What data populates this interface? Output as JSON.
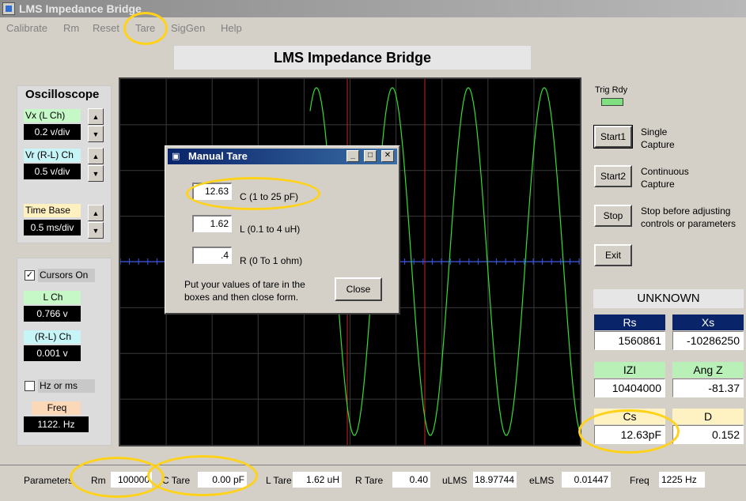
{
  "window": {
    "title": "LMS Impedance Bridge"
  },
  "menu": [
    "Calibrate",
    "Rm",
    "Reset",
    "Tare",
    "SigGen",
    "Help"
  ],
  "banner": "LMS Impedance Bridge",
  "oscilloscope": {
    "title": "Oscilloscope",
    "vx_label": "Vx  (L Ch)",
    "vx_value": "0.2 v/div",
    "vr_label": "Vr (R-L) Ch",
    "vr_value": "0.5 v/div",
    "timebase_label": "Time Base",
    "timebase_value": "0.5 ms/div"
  },
  "cursors": {
    "cursors_label": "Cursors On",
    "cursors_checked": "✓",
    "lch_label": "L Ch",
    "lch_value": "0.766 v",
    "rl_label": "(R-L) Ch",
    "rl_value": "0.001 v",
    "hz_label": "Hz or ms",
    "freq_label": "Freq",
    "freq_value": "1122. Hz"
  },
  "controls": {
    "trig_label": "Trig Rdy",
    "start1": "Start1",
    "start1_desc_1": "Single",
    "start1_desc_2": "Capture",
    "start2": "Start2",
    "start2_desc_1": "Continuous",
    "start2_desc_2": "Capture",
    "stop": "Stop",
    "stop_desc_1": "Stop before adjusting",
    "stop_desc_2": "controls or parameters",
    "exit": "Exit"
  },
  "unknown": {
    "title": "UNKNOWN",
    "rs_label": "Rs",
    "rs_value": "1560861",
    "xs_label": "Xs",
    "xs_value": "-10286250",
    "z_label": "IZI",
    "z_value": "10404000",
    "angz_label": "Ang Z",
    "angz_value": "-81.37",
    "cs_label": "Cs",
    "cs_value": "12.63pF",
    "d_label": "D",
    "d_value": "0.152"
  },
  "dialog": {
    "title": "Manual Tare",
    "c_value": "12.63",
    "c_label": "C  (1 to 25 pF)",
    "l_value": "1.62",
    "l_label": "L (0.1 to 4 uH)",
    "r_value": ".4",
    "r_label": "R (0 To 1 ohm)",
    "note_1": "Put your values of tare in the",
    "note_2": "boxes and then close form.",
    "close": "Close",
    "min": "_",
    "max": "□",
    "x": "✕"
  },
  "status": {
    "params_label": "Parameters",
    "rm_label": "Rm",
    "rm_value": "100000",
    "ctare_label": "C Tare",
    "ctare_value": "0.00 pF",
    "ltare_label": "L Tare",
    "ltare_value": "1.62 uH",
    "rtare_label": "R Tare",
    "rtare_value": "0.40",
    "ulms_label": "uLMS",
    "ulms_value": "18.97744",
    "elms_label": "eLMS",
    "elms_value": "0.01447",
    "freq_label": "Freq",
    "freq_value": "1225 Hz"
  },
  "colors": {
    "trace": "#33dd33",
    "cursor": "#cc2222",
    "axis": "#3355ff",
    "highlight": "#ffd21a"
  }
}
